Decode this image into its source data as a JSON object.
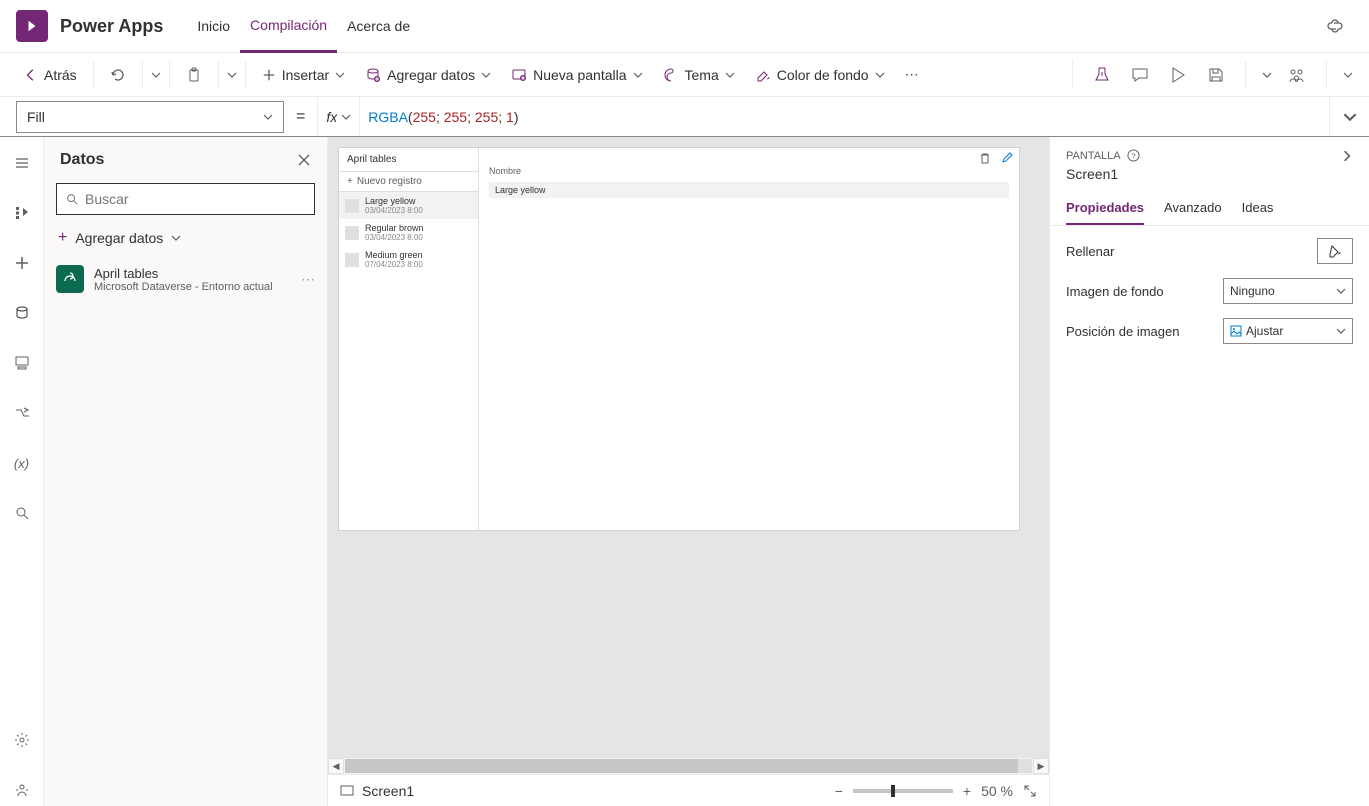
{
  "header": {
    "app_title": "Power Apps",
    "tabs": [
      "Inicio",
      "Compilación",
      "Acerca de"
    ],
    "active_tab": 1
  },
  "toolbar": {
    "back": "Atrás",
    "insert": "Insertar",
    "add_data": "Agregar datos",
    "new_screen": "Nueva pantalla",
    "theme": "Tema",
    "bg_color": "Color de fondo"
  },
  "formula": {
    "property": "Fill",
    "fn": "RGBA",
    "args": [
      "255",
      "255",
      "255",
      "1"
    ]
  },
  "datos": {
    "title": "Datos",
    "search_placeholder": "Buscar",
    "add_data": "Agregar datos",
    "source": {
      "name": "April tables",
      "provider": "Microsoft Dataverse - Entorno actual"
    }
  },
  "canvas": {
    "table_title": "April tables",
    "new_record": "Nuevo registro",
    "records": [
      {
        "name": "Large yellow",
        "ts": "03/04/2023 8:00"
      },
      {
        "name": "Regular brown",
        "ts": "03/04/2023 8:00"
      },
      {
        "name": "Medium green",
        "ts": "07/04/2023 8:00"
      }
    ],
    "detail_header": "Nombre",
    "detail_value": "Large yellow"
  },
  "status": {
    "screen": "Screen1",
    "zoom": "50  %"
  },
  "props": {
    "section": "PANTALLA",
    "screen": "Screen1",
    "tabs": [
      "Propiedades",
      "Avanzado",
      "Ideas"
    ],
    "rows": {
      "fill": "Rellenar",
      "bg_image": "Imagen de fondo",
      "bg_image_val": "Ninguno",
      "img_pos": "Posición de imagen",
      "img_pos_val": "Ajustar"
    }
  }
}
